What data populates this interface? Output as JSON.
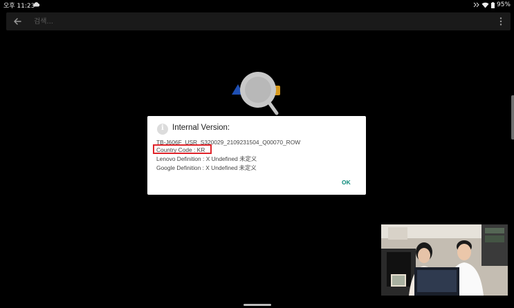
{
  "status_bar": {
    "time": "오후 11:23",
    "battery": "95%"
  },
  "search": {
    "placeholder": "검색..."
  },
  "dialog": {
    "title": "Internal Version:",
    "lines": [
      "TB-J606F_USR_S320029_2109231504_Q00070_ROW",
      "Country Code : KR",
      "Lenovo Definition : X Undefined 未定义",
      "Google Definition : X Undefined 未定义"
    ],
    "ok_label": "OK",
    "highlight_color": "#e0252b",
    "accent_color": "#0a8a7a"
  }
}
